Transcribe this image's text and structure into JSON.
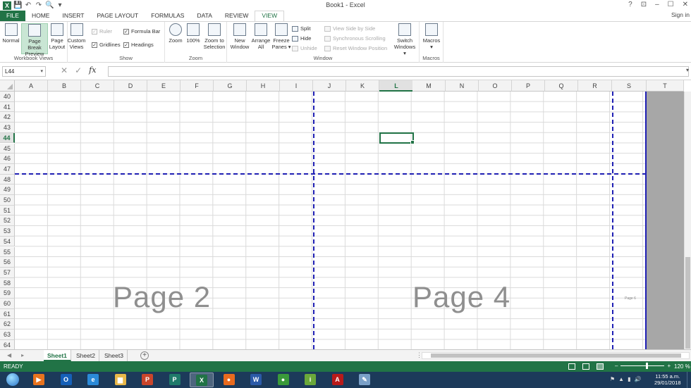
{
  "window": {
    "title": "Book1 - Excel",
    "help": "?",
    "ribbon_display": "⊡",
    "minimize": "–",
    "restore": "☐",
    "close": "✕",
    "sign_in": "Sign in"
  },
  "qat": {
    "save": "💾",
    "undo": "↶",
    "redo": "↷",
    "print_preview": "🔍",
    "customize": "▾"
  },
  "ribbon_tabs": [
    "FILE",
    "HOME",
    "INSERT",
    "PAGE LAYOUT",
    "FORMULAS",
    "DATA",
    "REVIEW",
    "VIEW"
  ],
  "active_tab": "VIEW",
  "ribbon": {
    "workbook_views": {
      "label": "Workbook Views",
      "normal": "Normal",
      "page_break_preview": [
        "Page Break",
        "Preview"
      ],
      "page_layout": [
        "Page",
        "Layout"
      ],
      "custom_views": [
        "Custom",
        "Views"
      ]
    },
    "show": {
      "label": "Show",
      "ruler": "Ruler",
      "formula_bar": "Formula Bar",
      "gridlines": "Gridlines",
      "headings": "Headings",
      "check": "✓"
    },
    "zoom": {
      "label": "Zoom",
      "zoom": "Zoom",
      "hundred": "100%",
      "zoom_to_selection": [
        "Zoom to",
        "Selection"
      ]
    },
    "window": {
      "label": "Window",
      "new_window": [
        "New",
        "Window"
      ],
      "arrange_all": [
        "Arrange",
        "All"
      ],
      "freeze_panes": [
        "Freeze",
        "Panes ▾"
      ],
      "split": "Split",
      "hide": "Hide",
      "unhide": "Unhide",
      "view_side_by_side": "View Side by Side",
      "synchronous_scrolling": "Synchronous Scrolling",
      "reset_window_position": "Reset Window Position",
      "switch_windows": [
        "Switch",
        "Windows ▾"
      ]
    },
    "macros": {
      "label": "Macros",
      "macros": [
        "Macros",
        "▾"
      ]
    }
  },
  "formula_bar": {
    "name_box": "L44",
    "name_box_dropdown": "▾",
    "cancel": "✕",
    "enter": "✓",
    "fx": "fx",
    "expand": "▾",
    "value": ""
  },
  "columns": [
    "A",
    "B",
    "C",
    "D",
    "E",
    "F",
    "G",
    "H",
    "I",
    "J",
    "K",
    "L",
    "M",
    "N",
    "O",
    "P",
    "Q",
    "R",
    "S",
    "T"
  ],
  "selected_column": "L",
  "rows": [
    "40",
    "41",
    "42",
    "43",
    "44",
    "45",
    "46",
    "47",
    "48",
    "49",
    "50",
    "51",
    "52",
    "53",
    "54",
    "55",
    "56",
    "57",
    "58",
    "59",
    "60",
    "61",
    "62",
    "63",
    "64"
  ],
  "selected_row": "44",
  "page_watermarks": {
    "page2": "Page 2",
    "page4": "Page 4",
    "page6": "Page 6"
  },
  "sheet_bar": {
    "first": "◀",
    "prev": "▸",
    "tabs": [
      "Sheet1",
      "Sheet2",
      "Sheet3"
    ],
    "active": "Sheet1",
    "add": "+",
    "ellipsis": "⋮"
  },
  "status_bar": {
    "ready": "READY",
    "zoom_out": "–",
    "zoom_in": "+",
    "zoom": "120 %"
  },
  "taskbar": {
    "apps": [
      {
        "name": "media-player",
        "glyph": "▶",
        "color": "#e8731e"
      },
      {
        "name": "outlook",
        "glyph": "O",
        "color": "#1560b8"
      },
      {
        "name": "internet-explorer",
        "glyph": "e",
        "color": "#2b8ad8"
      },
      {
        "name": "file-explorer",
        "glyph": "▆",
        "color": "#e8b84a"
      },
      {
        "name": "powerpoint",
        "glyph": "P",
        "color": "#c9452b"
      },
      {
        "name": "publisher",
        "glyph": "P",
        "color": "#1f7a6a"
      },
      {
        "name": "excel",
        "glyph": "X",
        "color": "#217346"
      },
      {
        "name": "firefox",
        "glyph": "●",
        "color": "#e86a1e"
      },
      {
        "name": "word",
        "glyph": "W",
        "color": "#2b5aa8"
      },
      {
        "name": "chrome",
        "glyph": "●",
        "color": "#3a9a3a"
      },
      {
        "name": "info-app",
        "glyph": "i",
        "color": "#6aa83a"
      },
      {
        "name": "acrobat",
        "glyph": "A",
        "color": "#b81a1a"
      },
      {
        "name": "paint",
        "glyph": "✎",
        "color": "#7aa0c8"
      }
    ],
    "tray": [
      "⚑",
      "▲",
      "▮",
      "🔊"
    ],
    "time": "11:55 a.m.",
    "date": "29/01/2018"
  }
}
